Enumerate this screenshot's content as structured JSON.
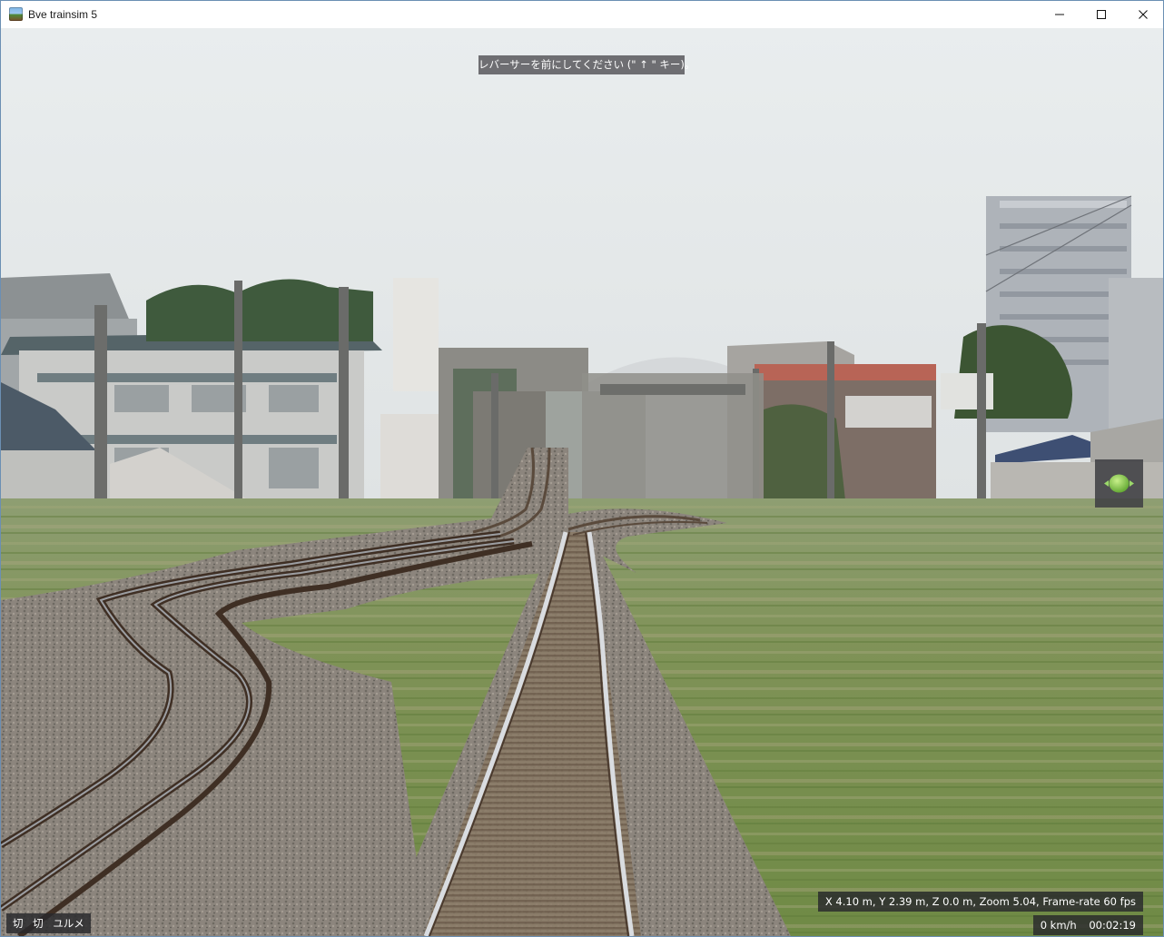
{
  "window": {
    "title": "Bve trainsim 5",
    "app_icon": "bve-trainsim-app-icon",
    "controls": [
      "minimize-icon",
      "maximize-icon",
      "close-icon"
    ]
  },
  "hud": {
    "message": "レバーサーを前にしてください (\" ↑ \" キー)。",
    "status_items": [
      "切",
      "切",
      "ユルメ"
    ],
    "debug_info": "X 4.10 m, Y 2.39 m, Z 0.0 m, Zoom 5.04, Frame-rate 60 fps",
    "speed": "0 km/h",
    "time": "00:02:19",
    "handle_indicator_icon": "reverser-neutral-icon"
  },
  "colors": {
    "sky": "#ebeeef",
    "grass": "#8a9a62",
    "ballast": "#8f8880",
    "rail": "#5a4a3c",
    "hud_background": "#2c2c30",
    "hud_text": "#ffffff",
    "indicator_green": "#7ecb47"
  }
}
